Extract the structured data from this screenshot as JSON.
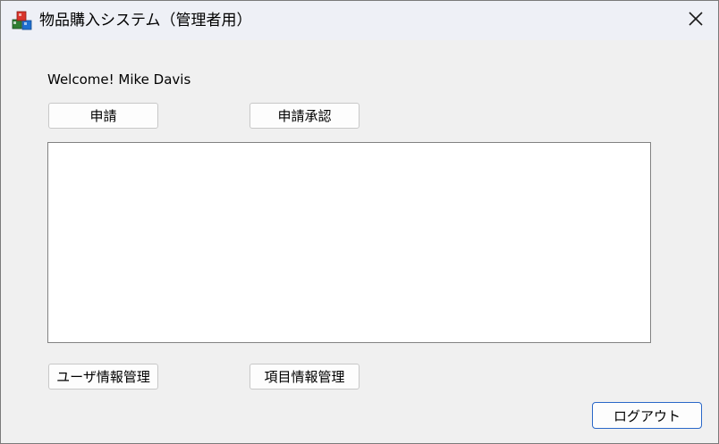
{
  "window": {
    "title": "物品購入システム（管理者用）"
  },
  "main": {
    "welcome_text": "Welcome! Mike Davis",
    "apply_label": "申請",
    "approve_label": "申請承認",
    "user_manage_label": "ユーザ情報管理",
    "item_manage_label": "項目情報管理",
    "logout_label": "ログアウト"
  },
  "icons": {
    "app": "app-blocks-icon",
    "close": "close-icon"
  },
  "colors": {
    "titlebar": "#eef0f6",
    "window_bg": "#f0f0f0",
    "logout_border": "#2a68c8"
  }
}
